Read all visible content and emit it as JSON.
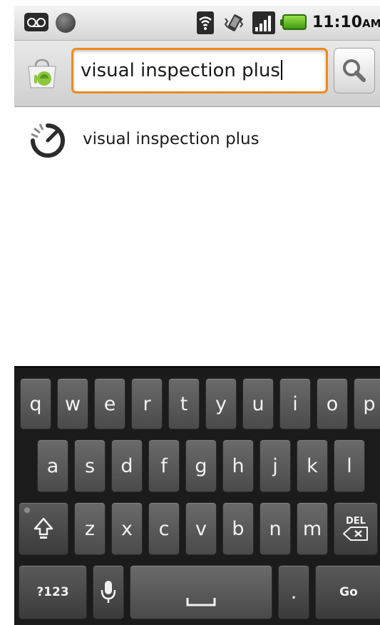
{
  "status_bar": {
    "time": "11:10",
    "ampm": "AM",
    "icons": [
      "voicemail-icon",
      "android-icon",
      "wifi-icon",
      "vibrate-icon",
      "signal-icon",
      "battery-icon"
    ]
  },
  "search": {
    "query": "visual inspection plus",
    "icons": [
      "market-icon",
      "search-icon"
    ],
    "accent": "#f08a1c"
  },
  "suggestions": [
    {
      "label": "visual inspection plus",
      "icon": "recent-search-icon"
    }
  ],
  "keyboard": {
    "row1": [
      "q",
      "w",
      "e",
      "r",
      "t",
      "y",
      "u",
      "i",
      "o",
      "p"
    ],
    "row2": [
      "a",
      "s",
      "d",
      "f",
      "g",
      "h",
      "j",
      "k",
      "l"
    ],
    "row3": [
      "z",
      "x",
      "c",
      "v",
      "b",
      "n",
      "m"
    ],
    "shift_icon": "shift-icon",
    "del_label": "DEL",
    "symbols_label": "?123",
    "mic_icon": "microphone-icon",
    "space_icon": "space-icon",
    "period_label": ".",
    "go_label": "Go"
  }
}
